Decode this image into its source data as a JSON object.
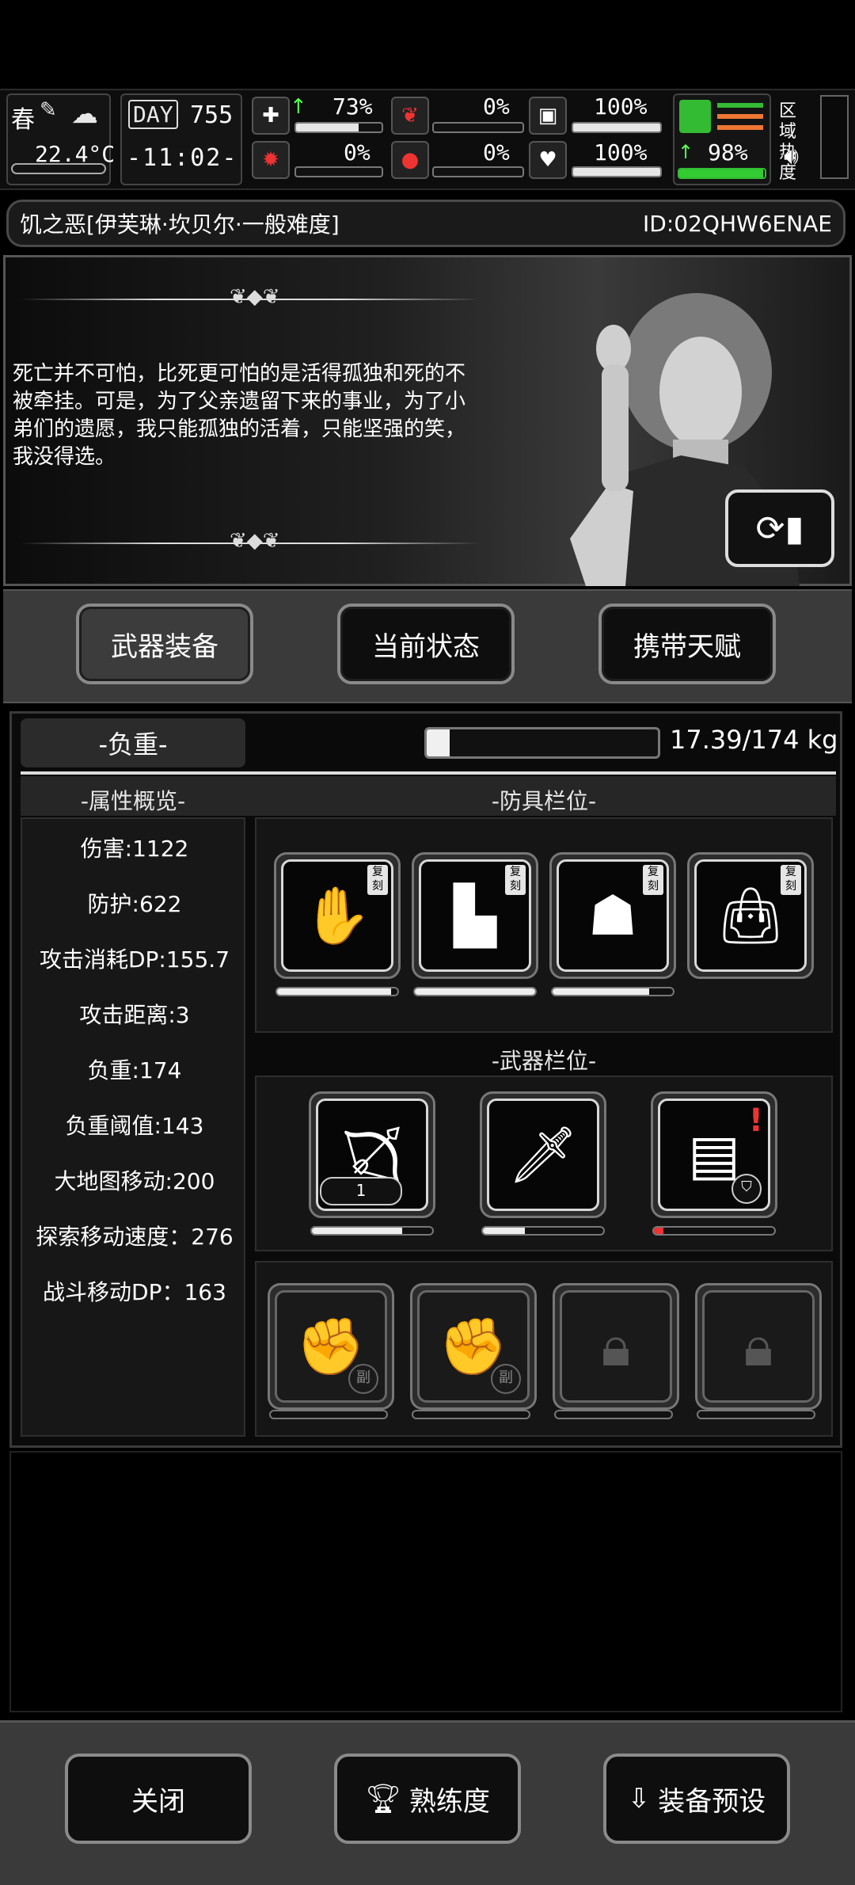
{
  "status": {
    "season": "春",
    "temperature": "22.4°C",
    "day_label": "DAY",
    "day": "755",
    "time": "-11:02-",
    "stats": {
      "health": "73%",
      "hunger": "0%",
      "thirst": "100%",
      "sanity": "0%",
      "bleed": "0%",
      "mood": "100%",
      "stamina": "98%"
    },
    "bars": {
      "health": 0.73,
      "hunger": 0.0,
      "thirst": 1.0,
      "sanity": 0.0,
      "bleed": 0.0,
      "mood": 1.0,
      "stamina": 0.98
    },
    "region_heat_label": "区域热度"
  },
  "title": {
    "name": "饥之恶[伊芙琳·坎贝尔·一般难度]",
    "id": "ID:02QHW6ENAE"
  },
  "story": {
    "text": "死亡并不可怕，比死更可怕的是活得孤独和死的不被牵挂。可是，为了父亲遗留下来的事业，为了小弟们的遗愿，我只能孤独的活着，只能坚强的笑，我没得选。"
  },
  "tabs": [
    "武器装备",
    "当前状态",
    "携带天赋"
  ],
  "load": {
    "label": "-负重-",
    "value": "17.39/174 kg",
    "fraction": 0.1
  },
  "sections": {
    "attributes": "-属性概览-",
    "armor": "-防具栏位-",
    "weapons": "-武器栏位-"
  },
  "attributes": [
    "伤害:1122",
    "防护:622",
    "攻击消耗DP:155.7",
    "攻击距离:3",
    "负重:174",
    "负重阈值:143",
    "大地图移动:200",
    "探索移动速度：276",
    "战斗移动DP：163"
  ],
  "armor_badge": "复刻",
  "armor_durability": [
    0.95,
    1.0,
    0.8,
    null
  ],
  "weapon_count": "1",
  "weapon_durability": [
    0.75,
    0.35,
    0.08
  ],
  "secondary_badge": "副",
  "buttons": {
    "close": "关闭",
    "proficiency": "熟练度",
    "preset": "装备预设"
  }
}
